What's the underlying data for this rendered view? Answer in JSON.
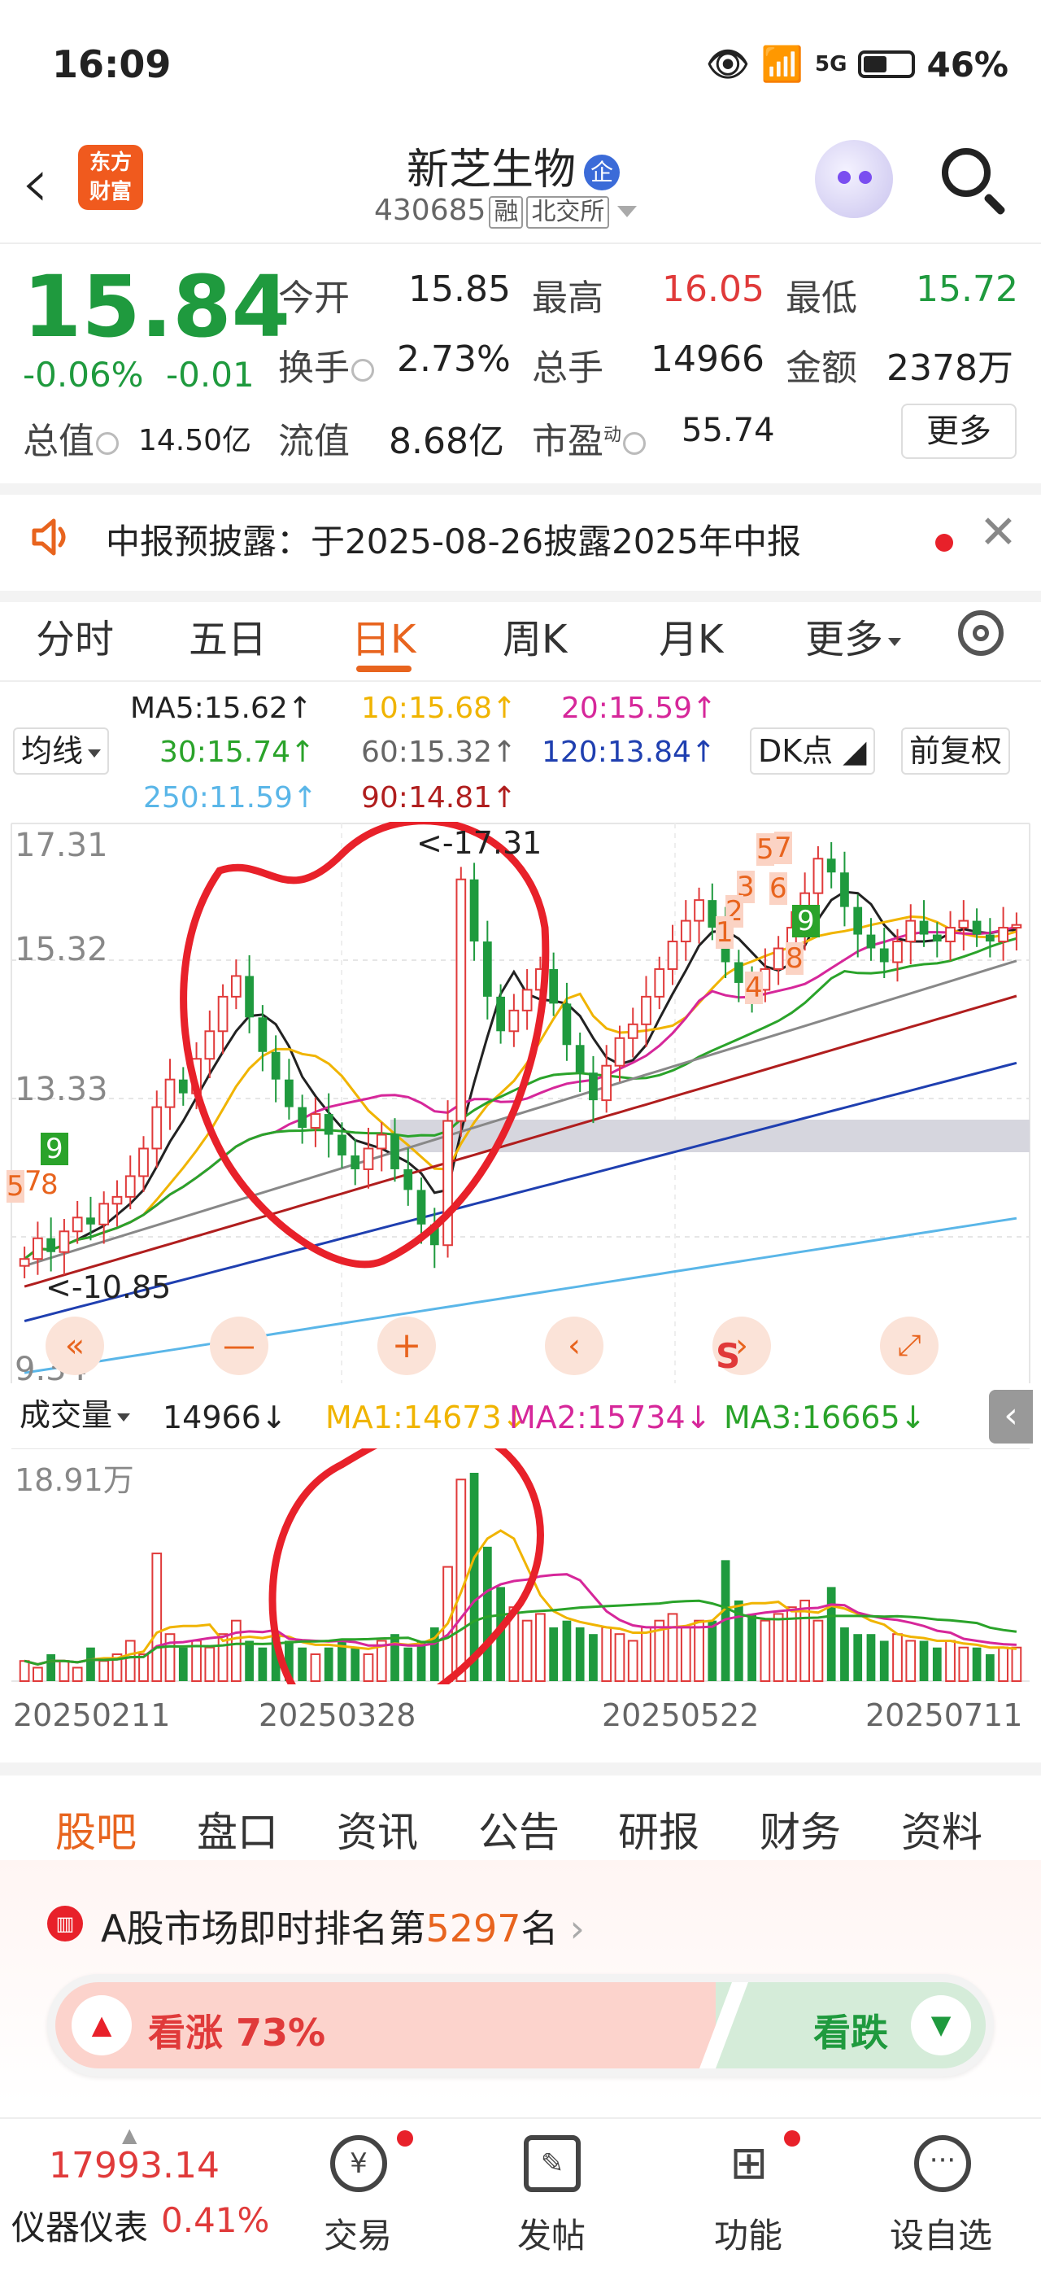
{
  "status_bar": {
    "time": "16:09",
    "battery": "46%",
    "net": "5G"
  },
  "header": {
    "brand_line1": "东方",
    "brand_line2": "财富",
    "stock_name": "新芝生物",
    "badge": "企",
    "code": "430685",
    "tag1": "融",
    "tag2": "北交所"
  },
  "quote": {
    "price": "15.84",
    "change_pct": "-0.06%",
    "change": "-0.01",
    "open_label": "今开",
    "open": "15.85",
    "high_label": "最高",
    "high": "16.05",
    "low_label": "最低",
    "low": "15.72",
    "turnover_label": "换手",
    "turnover": "2.73%",
    "volume_label": "总手",
    "volume": "14966",
    "amount_label": "金额",
    "amount": "2378万",
    "mcap_label": "总值",
    "mcap": "14.50亿",
    "float_label": "流值",
    "float": "8.68亿",
    "pe_label": "市盈",
    "pe_sup": "动",
    "pe": "55.74",
    "more": "更多"
  },
  "notice": {
    "text": "中报预披露：于2025-08-26披露2025年中报"
  },
  "chart_tabs": [
    "分时",
    "五日",
    "日K",
    "周K",
    "月K",
    "更多"
  ],
  "active_tab": 2,
  "ma_legend": {
    "selector": "均线",
    "ma5": "MA5:15.62↑",
    "ma10": "10:15.68↑",
    "ma20": "20:15.59↑",
    "ma30": "30:15.74↑",
    "ma60": "60:15.32↑",
    "ma120": "120:13.84↑",
    "ma250": "250:11.59↑",
    "ma90": "90:14.81↑",
    "dk": "DK点",
    "fq": "前复权"
  },
  "price_axis": [
    "17.31",
    "15.32",
    "13.33",
    "9.34"
  ],
  "annotations": {
    "max": "<-17.31",
    "min": "<-10.85"
  },
  "kline_marks": [
    "5",
    "7",
    "8",
    "9",
    "5",
    "7",
    "3",
    "6",
    "2",
    "1",
    "9",
    "8",
    "4"
  ],
  "volume_legend": {
    "selector": "成交量",
    "value": "14966↓",
    "ma1": "MA1:14673↓",
    "ma2": "MA2:15734↓",
    "ma3": "MA3:16665↓"
  },
  "volume_axis": "18.91万",
  "dates": [
    "20250211",
    "20250328",
    "20250522",
    "20250711"
  ],
  "chart_controls": {
    "s": "S"
  },
  "bottom_tabs": [
    "股吧",
    "盘口",
    "资讯",
    "公告",
    "研报",
    "财务",
    "资料"
  ],
  "rank": {
    "prefix": "A股市场即时排名第",
    "num": "5297",
    "suffix": "名"
  },
  "sentiment": {
    "up": "看涨 73%",
    "down": "看跌"
  },
  "bottom_nav": {
    "index_value": "17993.14",
    "index_name": "仪器仪表",
    "index_pct": "0.41%",
    "trade": "交易",
    "post": "发帖",
    "func": "功能",
    "watch": "设自选"
  },
  "colors": {
    "up": "#e03a3a",
    "down": "#1f9a3e",
    "accent": "#e8641e",
    "ma5": "#222222",
    "ma10": "#f0b400",
    "ma20": "#d6279a",
    "ma30": "#2aa32a",
    "ma60": "#888888",
    "ma120": "#1f3fb0",
    "ma250": "#5ab6e8",
    "ma90": "#b01e1e"
  },
  "chart_data": {
    "type": "candlestick",
    "x_start": "20250211",
    "x_end": "20250711",
    "ylim": [
      9.34,
      17.31
    ],
    "close": [
      11.0,
      11.3,
      11.1,
      11.4,
      11.6,
      11.5,
      11.8,
      11.9,
      12.2,
      12.6,
      13.2,
      13.6,
      13.4,
      13.9,
      14.3,
      14.8,
      15.1,
      14.5,
      14.0,
      13.6,
      13.2,
      12.9,
      13.1,
      12.8,
      12.5,
      12.3,
      12.6,
      12.8,
      12.3,
      12.0,
      11.5,
      11.2,
      13.0,
      16.5,
      15.6,
      14.8,
      14.3,
      14.6,
      14.9,
      15.2,
      14.7,
      14.1,
      13.7,
      13.3,
      13.8,
      14.2,
      14.4,
      14.8,
      15.2,
      15.6,
      15.9,
      16.2,
      15.8,
      15.3,
      15.0,
      14.9,
      15.2,
      15.5,
      15.8,
      16.3,
      16.8,
      16.6,
      16.1,
      15.7,
      15.5,
      15.3,
      15.6,
      15.9,
      15.7,
      15.6,
      15.8,
      15.9,
      15.7,
      15.6,
      15.8,
      15.84
    ],
    "volume": [
      3,
      2,
      4,
      3,
      2,
      5,
      3,
      4,
      6,
      4,
      19,
      7,
      5,
      6,
      5,
      7,
      9,
      6,
      5,
      7,
      6,
      5,
      4,
      5,
      6,
      5,
      4,
      6,
      7,
      5,
      6,
      8,
      17,
      30,
      31,
      20,
      14,
      11,
      9,
      10,
      8,
      9,
      8,
      7,
      8,
      7,
      6,
      8,
      9,
      10,
      8,
      9,
      9,
      18,
      12,
      10,
      9,
      10,
      11,
      12,
      9,
      14,
      8,
      7,
      7,
      6,
      7,
      6,
      6,
      5,
      6,
      5,
      5,
      4,
      5,
      5
    ]
  }
}
